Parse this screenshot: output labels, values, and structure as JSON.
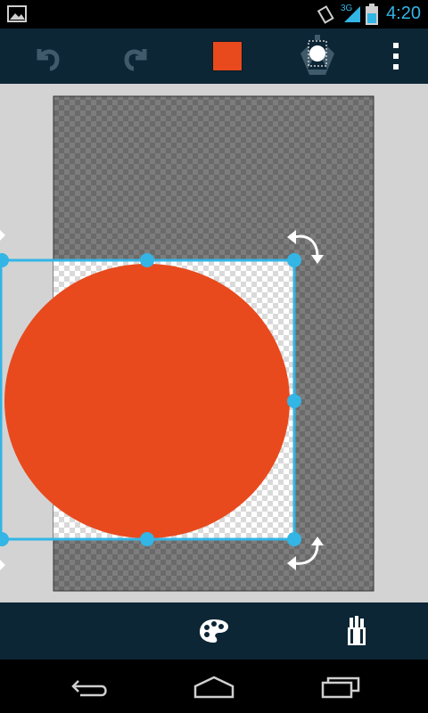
{
  "status_bar": {
    "time": "4:20",
    "network_type": "3G",
    "icons": [
      "gallery-notification-icon",
      "vibrate-icon",
      "signal-icon",
      "battery-icon"
    ]
  },
  "toolbar": {
    "items": [
      "undo-icon",
      "redo-icon",
      "color-swatch",
      "lightbulb-icon",
      "overflow-menu-icon"
    ],
    "current_color": "#e84a1e"
  },
  "bottom_bar": {
    "items": [
      "palette-icon",
      "tools-icon"
    ]
  },
  "nav_bar": {
    "items": [
      "back-icon",
      "home-icon",
      "recent-apps-icon"
    ]
  },
  "colors": {
    "accent": "#33b5e5",
    "bar_background": "#0c2635",
    "shape_fill": "#e84a1e"
  }
}
